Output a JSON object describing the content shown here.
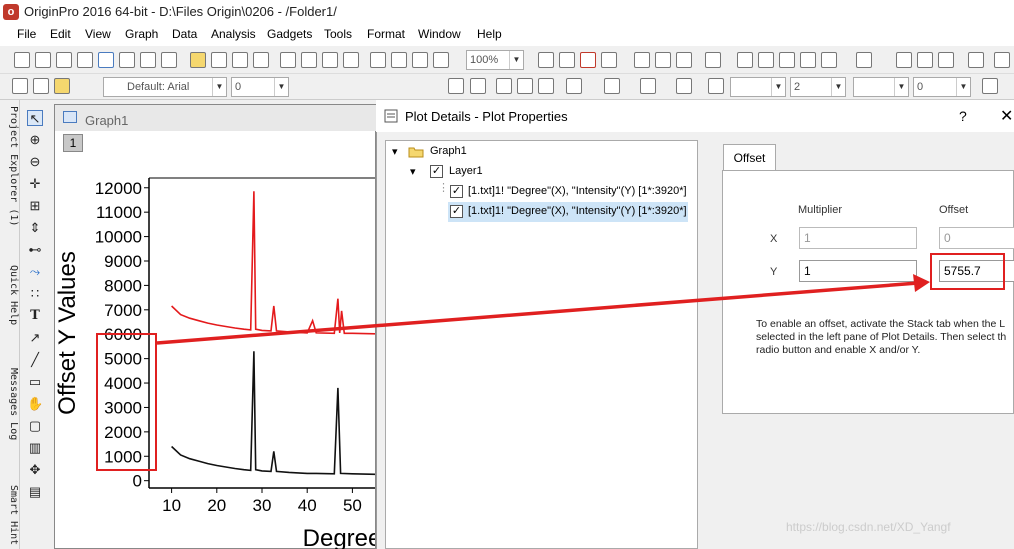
{
  "window": {
    "title": "OriginPro 2016 64-bit - D:\\Files Origin\\0206 - /Folder1/"
  },
  "menu": [
    "File",
    "Edit",
    "View",
    "Graph",
    "Data",
    "Analysis",
    "Gadgets",
    "Tools",
    "Format",
    "Window",
    "Help"
  ],
  "toolbar": {
    "zoom": "100%",
    "font": "Default: Arial",
    "font_size": "0",
    "bold": "B",
    "italic": "I",
    "underline": "U",
    "superscript": "x²",
    "subscript": "x₂",
    "alpha_beta": "αβ",
    "line_width": "2",
    "pattern_value": "0"
  },
  "side_tabs": [
    "Project Explorer (1)",
    "Quick Help",
    "Messages Log",
    "Smart Hint"
  ],
  "graph": {
    "window_title": "Graph1",
    "layer_number": "1",
    "ylabel": "Offset Y Values",
    "xlabel": "Degree"
  },
  "chart_data": {
    "type": "line",
    "ylabel": "Offset Y Values",
    "xlabel": "Degree",
    "yticks": [
      "12000",
      "11000",
      "10000",
      "9000",
      "8000",
      "7000",
      "6000",
      "5000",
      "4000",
      "3000",
      "2000",
      "1000",
      "0"
    ],
    "xticks": [
      "10",
      "20",
      "30",
      "40",
      "50"
    ],
    "xlim": [
      5,
      55
    ],
    "ylim": [
      -300,
      12400
    ],
    "series": [
      {
        "color": "#e41a1c",
        "offset": 5755.7,
        "points": [
          [
            10,
            1400
          ],
          [
            12,
            1050
          ],
          [
            14,
            900
          ],
          [
            16,
            800
          ],
          [
            18,
            700
          ],
          [
            20,
            620
          ],
          [
            22,
            560
          ],
          [
            24,
            500
          ],
          [
            26,
            450
          ],
          [
            27.5,
            420
          ],
          [
            28.2,
            6100
          ],
          [
            28.6,
            450
          ],
          [
            30,
            400
          ],
          [
            32,
            380
          ],
          [
            32.6,
            1400
          ],
          [
            33.2,
            380
          ],
          [
            36,
            340
          ],
          [
            40,
            300
          ],
          [
            41.2,
            800
          ],
          [
            42,
            300
          ],
          [
            46,
            280
          ],
          [
            46.8,
            1700
          ],
          [
            47.2,
            300
          ],
          [
            47.6,
            1200
          ],
          [
            48.2,
            280
          ],
          [
            50,
            280
          ],
          [
            55,
            260
          ]
        ]
      },
      {
        "color": "#111111",
        "offset": 0,
        "points": [
          [
            10,
            1400
          ],
          [
            12,
            1050
          ],
          [
            14,
            900
          ],
          [
            16,
            800
          ],
          [
            18,
            700
          ],
          [
            20,
            620
          ],
          [
            22,
            560
          ],
          [
            24,
            500
          ],
          [
            26,
            450
          ],
          [
            27.5,
            420
          ],
          [
            28.2,
            5300
          ],
          [
            28.6,
            450
          ],
          [
            30,
            400
          ],
          [
            32,
            380
          ],
          [
            32.6,
            1200
          ],
          [
            33.2,
            380
          ],
          [
            36,
            340
          ],
          [
            40,
            300
          ],
          [
            42,
            300
          ],
          [
            46,
            280
          ],
          [
            46.8,
            3800
          ],
          [
            47.4,
            300
          ],
          [
            50,
            280
          ],
          [
            55,
            260
          ]
        ]
      }
    ]
  },
  "dialog": {
    "title": "Plot Details - Plot Properties",
    "help": "?",
    "close": "✕",
    "tree": {
      "graph": "Graph1",
      "layer": "Layer1",
      "plots": [
        "[1.txt]1! \"Degree\"(X), \"Intensity\"(Y) [1*:3920*]",
        "[1.txt]1! \"Degree\"(X), \"Intensity\"(Y) [1*:3920*]"
      ]
    },
    "tab": "Offset",
    "multiplier_label": "Multiplier",
    "offset_label": "Offset",
    "x_label": "X",
    "y_label": "Y",
    "x_multiplier": "1",
    "x_offset": "0",
    "y_multiplier": "1",
    "y_offset": "5755.7",
    "note_lines": [
      "To enable an offset, activate the Stack tab when the L",
      "selected in the left pane of Plot Details.  Then select th",
      "radio button and enable X and/or Y."
    ]
  },
  "watermark": "https://blog.csdn.net/XD_Yangf"
}
